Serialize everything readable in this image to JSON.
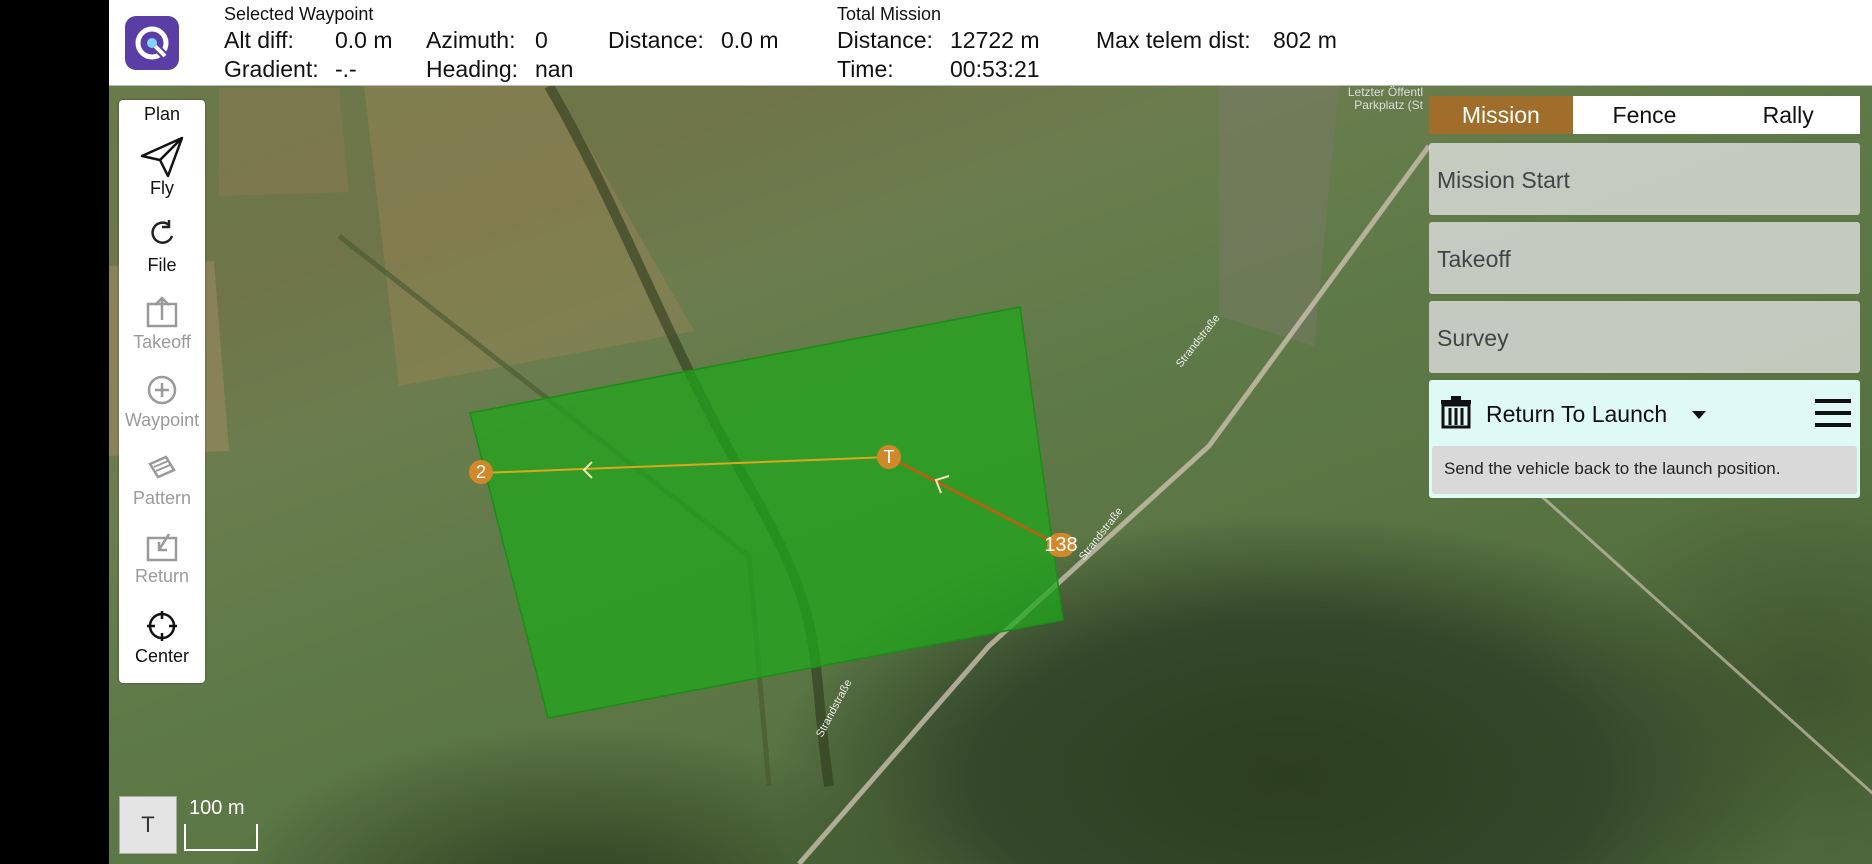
{
  "header": {
    "selected_waypoint_title": "Selected Waypoint",
    "alt_diff_label": "Alt diff:",
    "alt_diff_value": "0.0 m",
    "azimuth_label": "Azimuth:",
    "azimuth_value": "0",
    "distance_label": "Distance:",
    "distance_value": "0.0 m",
    "gradient_label": "Gradient:",
    "gradient_value": "-.-",
    "heading_label": "Heading:",
    "heading_value": "nan",
    "total_mission_title": "Total Mission",
    "total_distance_label": "Distance:",
    "total_distance_value": "12722 m",
    "time_label": "Time:",
    "time_value": "00:53:21",
    "max_telem_label": "Max telem dist:",
    "max_telem_value": "802 m"
  },
  "toolbar": {
    "plan": "Plan",
    "fly": "Fly",
    "file": "File",
    "takeoff": "Takeoff",
    "waypoint": "Waypoint",
    "pattern": "Pattern",
    "return": "Return",
    "center": "Center"
  },
  "panel": {
    "tabs": [
      "Mission",
      "Fence",
      "Rally"
    ],
    "items": [
      "Mission Start",
      "Takeoff",
      "Survey"
    ],
    "rtl_title": "Return To Launch",
    "rtl_description": "Send the vehicle back to the launch position."
  },
  "map": {
    "scale_button": "T",
    "scale_text": "100 m",
    "waypoint_2": "2",
    "waypoint_t": "T",
    "waypoint_138": "138",
    "place_label": "Letzter Öffentl\nParkplatz (St",
    "road_label": "Strandstraße",
    "survey_color": "#1fa81b",
    "accent_color": "#a06d2a"
  }
}
